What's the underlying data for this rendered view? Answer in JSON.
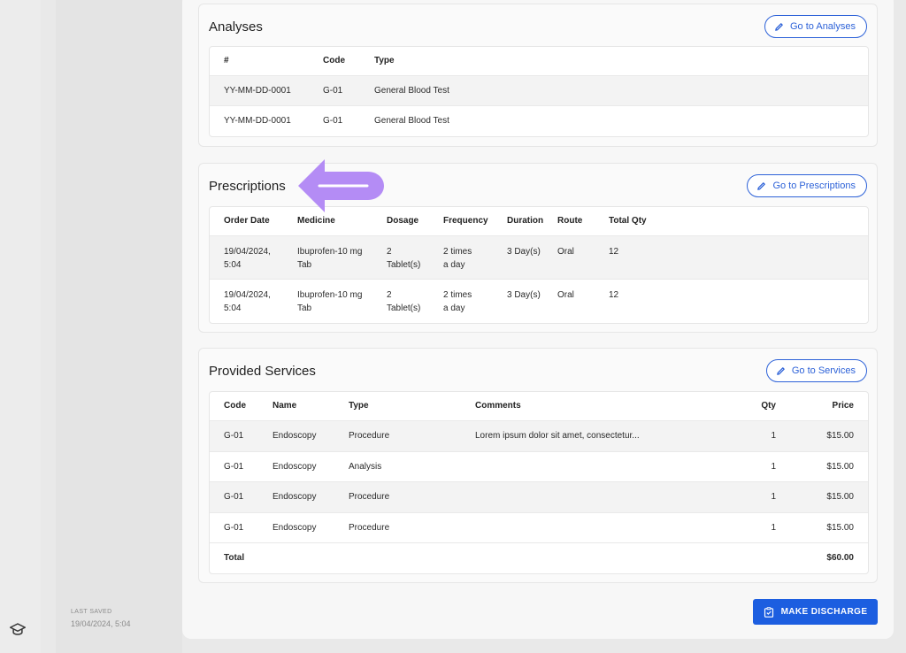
{
  "sidebar": {
    "bottom_icon": "graduation-cap-icon"
  },
  "footer": {
    "last_saved_label": "LAST SAVED",
    "last_saved_value": "19/04/2024, 5:04"
  },
  "analyses": {
    "title": "Analyses",
    "button": "Go to Analyses",
    "headers": [
      "#",
      "Code",
      "Type"
    ],
    "rows": [
      [
        "YY-MM-DD-0001",
        "G-01",
        "General Blood Test"
      ],
      [
        "YY-MM-DD-0001",
        "G-01",
        "General Blood Test"
      ]
    ]
  },
  "prescriptions": {
    "title": "Prescriptions",
    "button": "Go to Prescriptions",
    "headers": [
      "Order Date",
      "Medicine",
      "Dosage",
      "Frequency",
      "Duration",
      "Route",
      "Total Qty"
    ],
    "rows": [
      [
        [
          "19/04/2024,",
          "5:04"
        ],
        [
          "Ibuprofen-10 mg",
          "Tab"
        ],
        [
          "2",
          "Tablet(s)"
        ],
        [
          "2 times",
          "a day"
        ],
        [
          "3 Day(s)"
        ],
        [
          "Oral"
        ],
        [
          "12"
        ]
      ],
      [
        [
          "19/04/2024,",
          "5:04"
        ],
        [
          "Ibuprofen-10 mg",
          "Tab"
        ],
        [
          "2",
          "Tablet(s)"
        ],
        [
          "2 times",
          "a day"
        ],
        [
          "3 Day(s)"
        ],
        [
          "Oral"
        ],
        [
          "12"
        ]
      ]
    ]
  },
  "services": {
    "title": "Provided Services",
    "button": "Go to Services",
    "headers": [
      "Code",
      "Name",
      "Type",
      "Comments",
      "Qty",
      "Price"
    ],
    "rows": [
      [
        "G-01",
        "Endoscopy",
        "Procedure",
        "Lorem ipsum dolor sit amet, consectetur...",
        "1",
        "$15.00"
      ],
      [
        "G-01",
        "Endoscopy",
        "Analysis",
        "",
        "1",
        "$15.00"
      ],
      [
        "G-01",
        "Endoscopy",
        "Procedure",
        "",
        "1",
        "$15.00"
      ],
      [
        "G-01",
        "Endoscopy",
        "Procedure",
        "",
        "1",
        "$15.00"
      ]
    ],
    "total_label": "Total",
    "total_value": "$60.00"
  },
  "actions": {
    "discharge_label": "MAKE DISCHARGE",
    "discharge_icon": "clipboard-check-icon",
    "edit_icon": "pencil-icon"
  },
  "annotation": {
    "arrow_color": "#b48cf5",
    "arrow_direction": "left"
  },
  "colors": {
    "accent": "#1c5ee0",
    "outline_button": "#2d62d8"
  }
}
